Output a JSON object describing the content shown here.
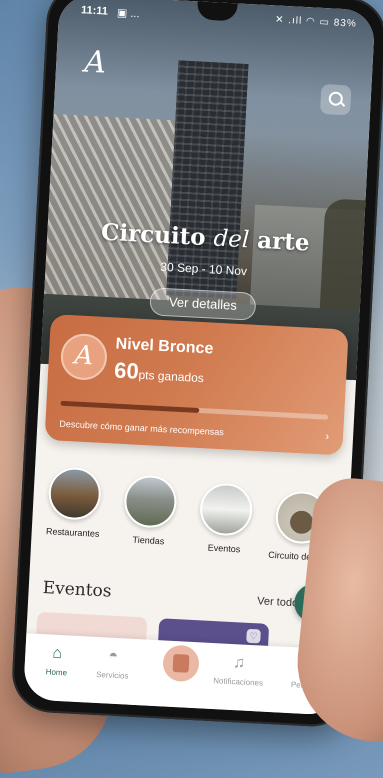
{
  "status": {
    "time": "11:11",
    "left_extra": "▣ ...",
    "right": "✕ .ıll ◠ ▭ 83%"
  },
  "hero": {
    "logo": "A",
    "title_part1": "Circuito ",
    "title_part2": "del",
    "title_part3": " arte",
    "dates": "30 Sep - 10 Nov",
    "details_button": "Ver detalles"
  },
  "level": {
    "avatar_letter": "A",
    "name": "Nivel Bronce",
    "points": "60",
    "points_label": "pts ganados",
    "progress": 0.52,
    "rewards_link": "Descubre cómo ganar más recompensas",
    "chevron": "›"
  },
  "categories": [
    {
      "label": "Restaurantes"
    },
    {
      "label": "Tiendas"
    },
    {
      "label": "Eventos"
    },
    {
      "label": "Circuito del arte"
    }
  ],
  "events": {
    "title": "Eventos",
    "see_all": "Ver todos ›",
    "fab": "✓",
    "heart": "♡"
  },
  "nav": {
    "home": "Home",
    "services": "Servicios",
    "notifications": "Notificaciones",
    "profile": "Perfil"
  },
  "colors": {
    "accent": "#2b6b59",
    "card": "#d07a4f"
  }
}
